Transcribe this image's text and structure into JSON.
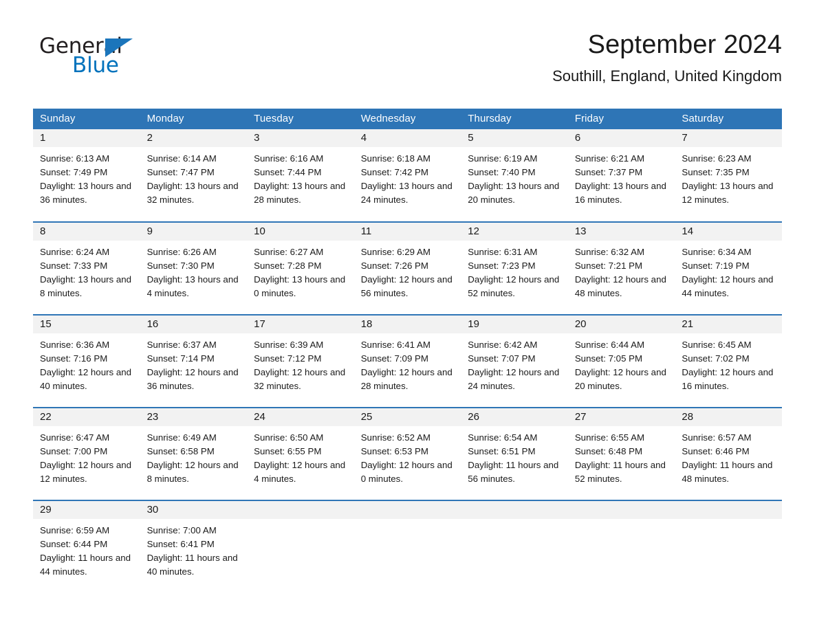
{
  "brand": {
    "name_part1": "General",
    "name_part2": "Blue",
    "triangle_color": "#1b75bb",
    "blue_color": "#0072bc"
  },
  "header": {
    "title": "September 2024",
    "location": "Southill, England, United Kingdom"
  },
  "theme": {
    "header_blue": "#2e75b6",
    "daynum_band": "#f2f2f2",
    "text": "#1a1a1a"
  },
  "calendar": {
    "weekday_headers": [
      "Sunday",
      "Monday",
      "Tuesday",
      "Wednesday",
      "Thursday",
      "Friday",
      "Saturday"
    ],
    "weeks": [
      [
        {
          "day": "1",
          "sunrise": "Sunrise: 6:13 AM",
          "sunset": "Sunset: 7:49 PM",
          "daylight": "Daylight: 13 hours and 36 minutes."
        },
        {
          "day": "2",
          "sunrise": "Sunrise: 6:14 AM",
          "sunset": "Sunset: 7:47 PM",
          "daylight": "Daylight: 13 hours and 32 minutes."
        },
        {
          "day": "3",
          "sunrise": "Sunrise: 6:16 AM",
          "sunset": "Sunset: 7:44 PM",
          "daylight": "Daylight: 13 hours and 28 minutes."
        },
        {
          "day": "4",
          "sunrise": "Sunrise: 6:18 AM",
          "sunset": "Sunset: 7:42 PM",
          "daylight": "Daylight: 13 hours and 24 minutes."
        },
        {
          "day": "5",
          "sunrise": "Sunrise: 6:19 AM",
          "sunset": "Sunset: 7:40 PM",
          "daylight": "Daylight: 13 hours and 20 minutes."
        },
        {
          "day": "6",
          "sunrise": "Sunrise: 6:21 AM",
          "sunset": "Sunset: 7:37 PM",
          "daylight": "Daylight: 13 hours and 16 minutes."
        },
        {
          "day": "7",
          "sunrise": "Sunrise: 6:23 AM",
          "sunset": "Sunset: 7:35 PM",
          "daylight": "Daylight: 13 hours and 12 minutes."
        }
      ],
      [
        {
          "day": "8",
          "sunrise": "Sunrise: 6:24 AM",
          "sunset": "Sunset: 7:33 PM",
          "daylight": "Daylight: 13 hours and 8 minutes."
        },
        {
          "day": "9",
          "sunrise": "Sunrise: 6:26 AM",
          "sunset": "Sunset: 7:30 PM",
          "daylight": "Daylight: 13 hours and 4 minutes."
        },
        {
          "day": "10",
          "sunrise": "Sunrise: 6:27 AM",
          "sunset": "Sunset: 7:28 PM",
          "daylight": "Daylight: 13 hours and 0 minutes."
        },
        {
          "day": "11",
          "sunrise": "Sunrise: 6:29 AM",
          "sunset": "Sunset: 7:26 PM",
          "daylight": "Daylight: 12 hours and 56 minutes."
        },
        {
          "day": "12",
          "sunrise": "Sunrise: 6:31 AM",
          "sunset": "Sunset: 7:23 PM",
          "daylight": "Daylight: 12 hours and 52 minutes."
        },
        {
          "day": "13",
          "sunrise": "Sunrise: 6:32 AM",
          "sunset": "Sunset: 7:21 PM",
          "daylight": "Daylight: 12 hours and 48 minutes."
        },
        {
          "day": "14",
          "sunrise": "Sunrise: 6:34 AM",
          "sunset": "Sunset: 7:19 PM",
          "daylight": "Daylight: 12 hours and 44 minutes."
        }
      ],
      [
        {
          "day": "15",
          "sunrise": "Sunrise: 6:36 AM",
          "sunset": "Sunset: 7:16 PM",
          "daylight": "Daylight: 12 hours and 40 minutes."
        },
        {
          "day": "16",
          "sunrise": "Sunrise: 6:37 AM",
          "sunset": "Sunset: 7:14 PM",
          "daylight": "Daylight: 12 hours and 36 minutes."
        },
        {
          "day": "17",
          "sunrise": "Sunrise: 6:39 AM",
          "sunset": "Sunset: 7:12 PM",
          "daylight": "Daylight: 12 hours and 32 minutes."
        },
        {
          "day": "18",
          "sunrise": "Sunrise: 6:41 AM",
          "sunset": "Sunset: 7:09 PM",
          "daylight": "Daylight: 12 hours and 28 minutes."
        },
        {
          "day": "19",
          "sunrise": "Sunrise: 6:42 AM",
          "sunset": "Sunset: 7:07 PM",
          "daylight": "Daylight: 12 hours and 24 minutes."
        },
        {
          "day": "20",
          "sunrise": "Sunrise: 6:44 AM",
          "sunset": "Sunset: 7:05 PM",
          "daylight": "Daylight: 12 hours and 20 minutes."
        },
        {
          "day": "21",
          "sunrise": "Sunrise: 6:45 AM",
          "sunset": "Sunset: 7:02 PM",
          "daylight": "Daylight: 12 hours and 16 minutes."
        }
      ],
      [
        {
          "day": "22",
          "sunrise": "Sunrise: 6:47 AM",
          "sunset": "Sunset: 7:00 PM",
          "daylight": "Daylight: 12 hours and 12 minutes."
        },
        {
          "day": "23",
          "sunrise": "Sunrise: 6:49 AM",
          "sunset": "Sunset: 6:58 PM",
          "daylight": "Daylight: 12 hours and 8 minutes."
        },
        {
          "day": "24",
          "sunrise": "Sunrise: 6:50 AM",
          "sunset": "Sunset: 6:55 PM",
          "daylight": "Daylight: 12 hours and 4 minutes."
        },
        {
          "day": "25",
          "sunrise": "Sunrise: 6:52 AM",
          "sunset": "Sunset: 6:53 PM",
          "daylight": "Daylight: 12 hours and 0 minutes."
        },
        {
          "day": "26",
          "sunrise": "Sunrise: 6:54 AM",
          "sunset": "Sunset: 6:51 PM",
          "daylight": "Daylight: 11 hours and 56 minutes."
        },
        {
          "day": "27",
          "sunrise": "Sunrise: 6:55 AM",
          "sunset": "Sunset: 6:48 PM",
          "daylight": "Daylight: 11 hours and 52 minutes."
        },
        {
          "day": "28",
          "sunrise": "Sunrise: 6:57 AM",
          "sunset": "Sunset: 6:46 PM",
          "daylight": "Daylight: 11 hours and 48 minutes."
        }
      ],
      [
        {
          "day": "29",
          "sunrise": "Sunrise: 6:59 AM",
          "sunset": "Sunset: 6:44 PM",
          "daylight": "Daylight: 11 hours and 44 minutes."
        },
        {
          "day": "30",
          "sunrise": "Sunrise: 7:00 AM",
          "sunset": "Sunset: 6:41 PM",
          "daylight": "Daylight: 11 hours and 40 minutes."
        },
        {
          "day": "",
          "sunrise": "",
          "sunset": "",
          "daylight": ""
        },
        {
          "day": "",
          "sunrise": "",
          "sunset": "",
          "daylight": ""
        },
        {
          "day": "",
          "sunrise": "",
          "sunset": "",
          "daylight": ""
        },
        {
          "day": "",
          "sunrise": "",
          "sunset": "",
          "daylight": ""
        },
        {
          "day": "",
          "sunrise": "",
          "sunset": "",
          "daylight": ""
        }
      ]
    ]
  }
}
